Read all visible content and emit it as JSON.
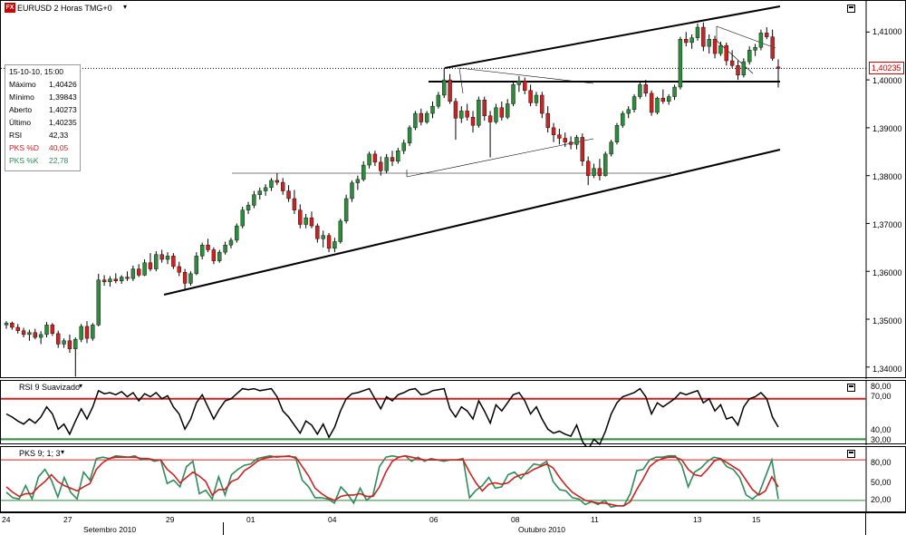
{
  "title": "EURUSD 2 Horas TMG+0",
  "logo": "FX",
  "colors": {
    "up": "#2e8b3c",
    "down": "#cc2222",
    "line": "#000000",
    "pks_d": "#cc2222",
    "pks_k": "#2e8b5a"
  },
  "info": {
    "datetime": "15-10-10, 15:00",
    "rows": [
      {
        "k": "Máximo",
        "v": "1,40426",
        "color": "#000000"
      },
      {
        "k": "Mínimo",
        "v": "1,39843",
        "color": "#000000"
      },
      {
        "k": "Aberto",
        "v": "1,40273",
        "color": "#000000"
      },
      {
        "k": "Último",
        "v": "1,40235",
        "color": "#000000"
      },
      {
        "k": "RSI",
        "v": "42,33",
        "color": "#000000"
      },
      {
        "k": "PKS %D",
        "v": "40,05",
        "color": "#cc2222"
      },
      {
        "k": "PKS %K",
        "v": "22,78",
        "color": "#2e8b5a"
      }
    ]
  },
  "price_axis": [
    "1,41000",
    "1,40000",
    "1,39000",
    "1,38000",
    "1,37000",
    "1,36000",
    "1,35000",
    "1,34000"
  ],
  "last_price": "1,40235",
  "rsi": {
    "title": "RSI 9 Suavizado",
    "axis": [
      "80,00",
      "70,00",
      "40,00",
      "30,00"
    ],
    "upper_level": "70,00",
    "lower_level": "30,00"
  },
  "pks": {
    "title": "PKS 9; 1; 3",
    "axis": [
      "80,00",
      "50,00",
      "20,00"
    ]
  },
  "time_axis": {
    "days": [
      "24",
      "27",
      "29",
      "01",
      "04",
      "06",
      "08",
      "11",
      "13",
      "15"
    ],
    "months": [
      "Setembro 2010",
      "Outubro 2010"
    ]
  },
  "chart_data": {
    "type": "candlestick",
    "title": "EURUSD 2 Horas TMG+0",
    "symbol": "EURUSD",
    "timeframe": "2 Horas",
    "ylim": [
      1.3375,
      1.4165
    ],
    "candles": [
      [
        1.3488,
        1.3496,
        1.348,
        1.3492
      ],
      [
        1.3492,
        1.3495,
        1.3478,
        1.3483
      ],
      [
        1.3483,
        1.349,
        1.347,
        1.3476
      ],
      [
        1.3476,
        1.3482,
        1.3462,
        1.3468
      ],
      [
        1.3468,
        1.3478,
        1.3455,
        1.3472
      ],
      [
        1.3472,
        1.348,
        1.3458,
        1.3462
      ],
      [
        1.3462,
        1.3475,
        1.3448,
        1.3468
      ],
      [
        1.3468,
        1.3494,
        1.3462,
        1.3488
      ],
      [
        1.3488,
        1.3492,
        1.3465,
        1.347
      ],
      [
        1.347,
        1.3476,
        1.344,
        1.3448
      ],
      [
        1.3448,
        1.346,
        1.344,
        1.3455
      ],
      [
        1.3455,
        1.3468,
        1.343,
        1.3438
      ],
      [
        1.3438,
        1.3462,
        1.338,
        1.3458
      ],
      [
        1.3458,
        1.349,
        1.3452,
        1.3485
      ],
      [
        1.3485,
        1.3496,
        1.345,
        1.346
      ],
      [
        1.346,
        1.3492,
        1.3455,
        1.3488
      ],
      [
        1.3488,
        1.3595,
        1.3485,
        1.3582
      ],
      [
        1.3582,
        1.3592,
        1.357,
        1.3578
      ],
      [
        1.3578,
        1.359,
        1.3568,
        1.3584
      ],
      [
        1.3584,
        1.3596,
        1.3575,
        1.358
      ],
      [
        1.358,
        1.3592,
        1.3574,
        1.3588
      ],
      [
        1.3588,
        1.36,
        1.358,
        1.3585
      ],
      [
        1.3585,
        1.3612,
        1.358,
        1.3605
      ],
      [
        1.3605,
        1.3615,
        1.3588,
        1.3592
      ],
      [
        1.3592,
        1.3625,
        1.359,
        1.3618
      ],
      [
        1.3618,
        1.3638,
        1.36,
        1.3605
      ],
      [
        1.3605,
        1.3642,
        1.36,
        1.3635
      ],
      [
        1.3635,
        1.3645,
        1.3618,
        1.3625
      ],
      [
        1.3625,
        1.364,
        1.3615,
        1.3632
      ],
      [
        1.3632,
        1.3638,
        1.3605,
        1.361
      ],
      [
        1.361,
        1.362,
        1.359,
        1.3598
      ],
      [
        1.3598,
        1.3605,
        1.356,
        1.3575
      ],
      [
        1.3575,
        1.36,
        1.357,
        1.3595
      ],
      [
        1.3595,
        1.364,
        1.3592,
        1.3632
      ],
      [
        1.3632,
        1.366,
        1.3625,
        1.3655
      ],
      [
        1.3655,
        1.3668,
        1.364,
        1.3645
      ],
      [
        1.3645,
        1.365,
        1.3615,
        1.3622
      ],
      [
        1.3622,
        1.3645,
        1.3618,
        1.364
      ],
      [
        1.364,
        1.3662,
        1.3635,
        1.3655
      ],
      [
        1.3655,
        1.367,
        1.3648,
        1.3665
      ],
      [
        1.3665,
        1.37,
        1.366,
        1.3695
      ],
      [
        1.3695,
        1.3735,
        1.369,
        1.3728
      ],
      [
        1.3728,
        1.3745,
        1.372,
        1.3738
      ],
      [
        1.3738,
        1.3768,
        1.3732,
        1.376
      ],
      [
        1.376,
        1.3775,
        1.375,
        1.3768
      ],
      [
        1.3768,
        1.3782,
        1.3758,
        1.3775
      ],
      [
        1.3775,
        1.3795,
        1.3768,
        1.379
      ],
      [
        1.379,
        1.3805,
        1.378,
        1.3786
      ],
      [
        1.3786,
        1.3795,
        1.376,
        1.3768
      ],
      [
        1.3768,
        1.378,
        1.3745,
        1.3752
      ],
      [
        1.3752,
        1.377,
        1.372,
        1.3728
      ],
      [
        1.3728,
        1.374,
        1.369,
        1.3698
      ],
      [
        1.3698,
        1.372,
        1.369,
        1.3712
      ],
      [
        1.3712,
        1.3725,
        1.369,
        1.3695
      ],
      [
        1.3695,
        1.37,
        1.366,
        1.3668
      ],
      [
        1.3668,
        1.3685,
        1.365,
        1.3675
      ],
      [
        1.3675,
        1.368,
        1.364,
        1.3648
      ],
      [
        1.3648,
        1.367,
        1.364,
        1.3662
      ],
      [
        1.3662,
        1.371,
        1.3658,
        1.3705
      ],
      [
        1.3705,
        1.376,
        1.37,
        1.3752
      ],
      [
        1.3752,
        1.379,
        1.3745,
        1.3785
      ],
      [
        1.3785,
        1.38,
        1.377,
        1.3792
      ],
      [
        1.3792,
        1.383,
        1.3788,
        1.3822
      ],
      [
        1.3822,
        1.385,
        1.3815,
        1.3845
      ],
      [
        1.3845,
        1.3852,
        1.382,
        1.3828
      ],
      [
        1.3828,
        1.384,
        1.38,
        1.381
      ],
      [
        1.381,
        1.3845,
        1.3805,
        1.3838
      ],
      [
        1.3838,
        1.3852,
        1.382,
        1.383
      ],
      [
        1.383,
        1.3858,
        1.3825,
        1.3852
      ],
      [
        1.3852,
        1.3875,
        1.3845,
        1.3868
      ],
      [
        1.3868,
        1.3905,
        1.3862,
        1.39
      ],
      [
        1.39,
        1.3935,
        1.3895,
        1.393
      ],
      [
        1.393,
        1.394,
        1.3905,
        1.3912
      ],
      [
        1.3912,
        1.3935,
        1.3908,
        1.393
      ],
      [
        1.393,
        1.3955,
        1.392,
        1.3945
      ],
      [
        1.3945,
        1.3975,
        1.394,
        1.3968
      ],
      [
        1.3968,
        1.4025,
        1.3962,
        1.4
      ],
      [
        1.4,
        1.4012,
        1.395,
        1.3955
      ],
      [
        1.3955,
        1.3962,
        1.3875,
        1.392
      ],
      [
        1.392,
        1.3945,
        1.391,
        1.3935
      ],
      [
        1.3935,
        1.395,
        1.3915,
        1.3922
      ],
      [
        1.3922,
        1.3935,
        1.389,
        1.3905
      ],
      [
        1.3905,
        1.3965,
        1.39,
        1.3958
      ],
      [
        1.3958,
        1.3965,
        1.3915,
        1.3925
      ],
      [
        1.3925,
        1.3935,
        1.3838,
        1.3912
      ],
      [
        1.3912,
        1.395,
        1.3908,
        1.3942
      ],
      [
        1.3942,
        1.3955,
        1.3915,
        1.3922
      ],
      [
        1.3922,
        1.396,
        1.3918,
        1.395
      ],
      [
        1.395,
        1.3995,
        1.3945,
        1.399
      ],
      [
        1.399,
        1.4008,
        1.3975,
        1.3998
      ],
      [
        1.3998,
        1.4005,
        1.397,
        1.3978
      ],
      [
        1.3978,
        1.399,
        1.3945,
        1.3952
      ],
      [
        1.3952,
        1.3975,
        1.3945,
        1.3968
      ],
      [
        1.3968,
        1.3975,
        1.392,
        1.393
      ],
      [
        1.393,
        1.3945,
        1.389,
        1.39
      ],
      [
        1.39,
        1.391,
        1.387,
        1.3885
      ],
      [
        1.3885,
        1.3898,
        1.3865,
        1.3878
      ],
      [
        1.3878,
        1.389,
        1.386,
        1.387
      ],
      [
        1.387,
        1.3882,
        1.3855,
        1.3865
      ],
      [
        1.3865,
        1.3885,
        1.3855,
        1.388
      ],
      [
        1.388,
        1.3888,
        1.382,
        1.383
      ],
      [
        1.383,
        1.384,
        1.378,
        1.38
      ],
      [
        1.38,
        1.3825,
        1.3795,
        1.3815
      ],
      [
        1.3815,
        1.3835,
        1.379,
        1.38
      ],
      [
        1.38,
        1.385,
        1.3798,
        1.3845
      ],
      [
        1.3845,
        1.3875,
        1.384,
        1.387
      ],
      [
        1.387,
        1.391,
        1.3865,
        1.3905
      ],
      [
        1.3905,
        1.3935,
        1.39,
        1.393
      ],
      [
        1.393,
        1.3945,
        1.392,
        1.3938
      ],
      [
        1.3938,
        1.397,
        1.3932,
        1.3965
      ],
      [
        1.3965,
        1.3995,
        1.396,
        1.399
      ],
      [
        1.399,
        1.4,
        1.3965,
        1.3972
      ],
      [
        1.3972,
        1.3978,
        1.3925,
        1.3932
      ],
      [
        1.3932,
        1.3965,
        1.3928,
        1.3962
      ],
      [
        1.3962,
        1.398,
        1.395,
        1.3955
      ],
      [
        1.3955,
        1.397,
        1.3948,
        1.3965
      ],
      [
        1.3965,
        1.399,
        1.3958,
        1.3985
      ],
      [
        1.3985,
        1.409,
        1.398,
        1.4085
      ],
      [
        1.4085,
        1.41,
        1.407,
        1.4078
      ],
      [
        1.4078,
        1.4095,
        1.4065,
        1.4088
      ],
      [
        1.4088,
        1.4118,
        1.4082,
        1.411
      ],
      [
        1.411,
        1.412,
        1.406,
        1.407
      ],
      [
        1.407,
        1.4095,
        1.4055,
        1.4085
      ],
      [
        1.4085,
        1.4092,
        1.4045,
        1.4055
      ],
      [
        1.4055,
        1.408,
        1.405,
        1.4072
      ],
      [
        1.4072,
        1.4078,
        1.403,
        1.404
      ],
      [
        1.404,
        1.4062,
        1.4025,
        1.403
      ],
      [
        1.403,
        1.404,
        1.4,
        1.401
      ],
      [
        1.401,
        1.4045,
        1.4005,
        1.4038
      ],
      [
        1.4038,
        1.407,
        1.4032,
        1.4062
      ],
      [
        1.4062,
        1.4075,
        1.405,
        1.4068
      ],
      [
        1.4068,
        1.4105,
        1.4062,
        1.4098
      ],
      [
        1.4098,
        1.411,
        1.4085,
        1.409
      ],
      [
        1.409,
        1.4105,
        1.404,
        1.4045
      ],
      [
        1.4027,
        1.4043,
        1.3984,
        1.4024
      ]
    ],
    "rsi_values": [
      55,
      52,
      48,
      45,
      50,
      46,
      52,
      62,
      55,
      40,
      45,
      35,
      48,
      60,
      50,
      62,
      78,
      75,
      76,
      74,
      77,
      72,
      76,
      68,
      75,
      72,
      76,
      70,
      73,
      62,
      55,
      40,
      50,
      66,
      74,
      62,
      50,
      60,
      68,
      70,
      75,
      80,
      79,
      80,
      78,
      79,
      80,
      72,
      58,
      52,
      44,
      36,
      48,
      44,
      35,
      45,
      32,
      42,
      58,
      70,
      75,
      76,
      78,
      80,
      70,
      60,
      72,
      68,
      74,
      76,
      79,
      80,
      74,
      75,
      78,
      79,
      80,
      60,
      52,
      62,
      58,
      50,
      68,
      58,
      46,
      64,
      58,
      66,
      74,
      76,
      68,
      55,
      62,
      50,
      40,
      36,
      38,
      35,
      33,
      44,
      28,
      20,
      30,
      25,
      38,
      55,
      66,
      72,
      74,
      76,
      80,
      72,
      55,
      66,
      62,
      66,
      70,
      76,
      74,
      76,
      78,
      66,
      70,
      58,
      64,
      50,
      52,
      44,
      62,
      70,
      72,
      76,
      70,
      52,
      42
    ],
    "pks_k": [
      32,
      24,
      22,
      42,
      22,
      55,
      66,
      50,
      25,
      54,
      32,
      22,
      62,
      50,
      82,
      84,
      82,
      86,
      85,
      84,
      86,
      80,
      82,
      78,
      80,
      45,
      50,
      40,
      70,
      78,
      30,
      35,
      22,
      55,
      28,
      58,
      66,
      72,
      74,
      82,
      84,
      86,
      84,
      85,
      86,
      82,
      50,
      40,
      24,
      24,
      22,
      16,
      40,
      30,
      16,
      38,
      20,
      28,
      70,
      84,
      86,
      84,
      86,
      78,
      84,
      78,
      82,
      80,
      78,
      80,
      80,
      82,
      24,
      35,
      42,
      54,
      38,
      40,
      58,
      62,
      52,
      64,
      74,
      72,
      78,
      48,
      36,
      34,
      24,
      22,
      14,
      18,
      14,
      20,
      10,
      12,
      12,
      30,
      64,
      66,
      80,
      84,
      84,
      86,
      86,
      72,
      40,
      62,
      68,
      78,
      84,
      82,
      70,
      66,
      54,
      28,
      22,
      30,
      55,
      80,
      22
    ],
    "pks_d": [
      40,
      32,
      26,
      30,
      30,
      40,
      48,
      58,
      48,
      42,
      38,
      34,
      40,
      45,
      66,
      76,
      82,
      84,
      84,
      84,
      84,
      82,
      82,
      80,
      80,
      66,
      58,
      46,
      54,
      62,
      56,
      48,
      28,
      36,
      36,
      48,
      52,
      64,
      70,
      78,
      82,
      84,
      85,
      85,
      85,
      84,
      70,
      56,
      38,
      30,
      24,
      20,
      26,
      28,
      28,
      30,
      26,
      26,
      40,
      62,
      78,
      84,
      86,
      84,
      82,
      80,
      80,
      80,
      80,
      80,
      80,
      80,
      62,
      46,
      34,
      44,
      46,
      44,
      46,
      54,
      58,
      60,
      66,
      70,
      74,
      68,
      54,
      42,
      32,
      26,
      20,
      18,
      16,
      16,
      14,
      12,
      12,
      18,
      36,
      52,
      70,
      78,
      82,
      84,
      84,
      80,
      66,
      58,
      56,
      66,
      78,
      82,
      76,
      70,
      64,
      50,
      36,
      28,
      34,
      55,
      40
    ]
  }
}
